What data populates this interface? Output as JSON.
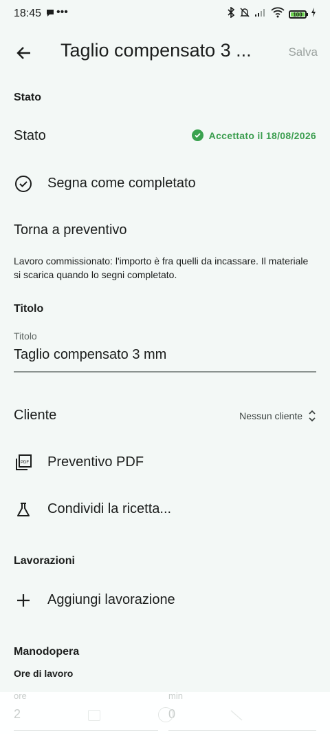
{
  "status_bar": {
    "time": "18:45",
    "extra": "•••",
    "battery": "100"
  },
  "app_bar": {
    "title": "Taglio compensato 3 ...",
    "save_label": "Salva"
  },
  "stato_section": {
    "heading": "Stato",
    "row_label": "Stato",
    "status_value": "Accettato il 18/08/2026",
    "complete_action": "Segna come completato",
    "back_action": "Torna a preventivo",
    "info": "Lavoro commissionato: l'importo è fra quelli da incassare. Il materiale si scarica quando lo segni completato."
  },
  "titolo_section": {
    "heading": "Titolo",
    "field_label": "Titolo",
    "field_value": "Taglio compensato 3 mm"
  },
  "cliente": {
    "label": "Cliente",
    "value": "Nessun cliente"
  },
  "actions": {
    "pdf": "Preventivo PDF",
    "share": "Condividi la ricetta..."
  },
  "lavorazioni": {
    "heading": "Lavorazioni",
    "add_label": "Aggiungi lavorazione"
  },
  "manodopera": {
    "heading": "Manodopera",
    "subheading": "Ore di lavoro",
    "hours_label": "ore",
    "hours_value": "2",
    "minutes_label": "min",
    "minutes_value": "0"
  },
  "colors": {
    "accent": "#3aa24f",
    "background": "#f3f8f6",
    "muted": "#9aa19e"
  }
}
